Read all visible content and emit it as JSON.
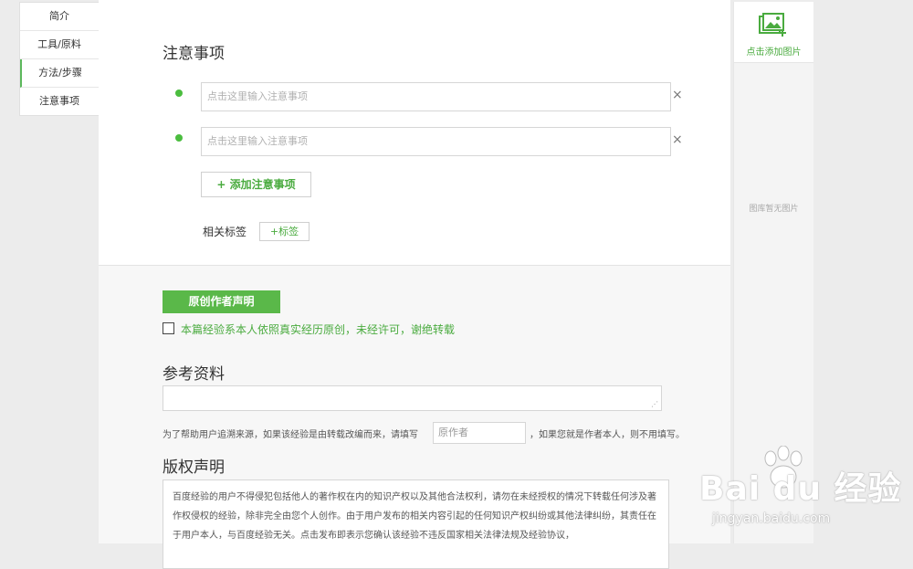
{
  "leftnav": {
    "items": [
      {
        "label": "简介"
      },
      {
        "label": "工具/原料"
      },
      {
        "label": "方法/步骤"
      },
      {
        "label": "注意事项"
      }
    ]
  },
  "notes": {
    "title": "注意事项",
    "placeholder": "点击这里输入注意事项",
    "delete_icon": "×",
    "add_label": "+ 添加注意事项"
  },
  "tags": {
    "label": "相关标签",
    "button": "+标签"
  },
  "original": {
    "button": "原创作者声明",
    "checkbox_text": "本篇经验系本人依照真实经历原创，未经许可，谢绝转载"
  },
  "reference": {
    "title": "参考资料",
    "source_text_before": "为了帮助用户追溯来源，如果该经验是由转载改编而来，请填写",
    "author_placeholder": "原作者",
    "source_text_after": "，如果您就是作者本人，则不用填写。"
  },
  "copyright": {
    "title": "版权声明",
    "text": "百度经验的用户不得侵犯包括他人的著作权在内的知识产权以及其他合法权利，请勿在未经授权的情况下转载任何涉及著作权侵权的经验，除非完全由您个人创作。由于用户发布的相关内容引起的任何知识产权纠纷或其他法律纠纷，其责任在于用户本人，与百度经验无关。点击发布即表示您确认该经验不违反国家相关法律法规及经验协议，"
  },
  "imagepanel": {
    "add_label": "点击添加图片",
    "empty_text": "图库暂无图片"
  },
  "watermark": {
    "brand": "Bai du 经验",
    "url": "jingyan.baidu.com"
  },
  "colors": {
    "accent": "#5ab849",
    "accent_text": "#4aab3f"
  }
}
